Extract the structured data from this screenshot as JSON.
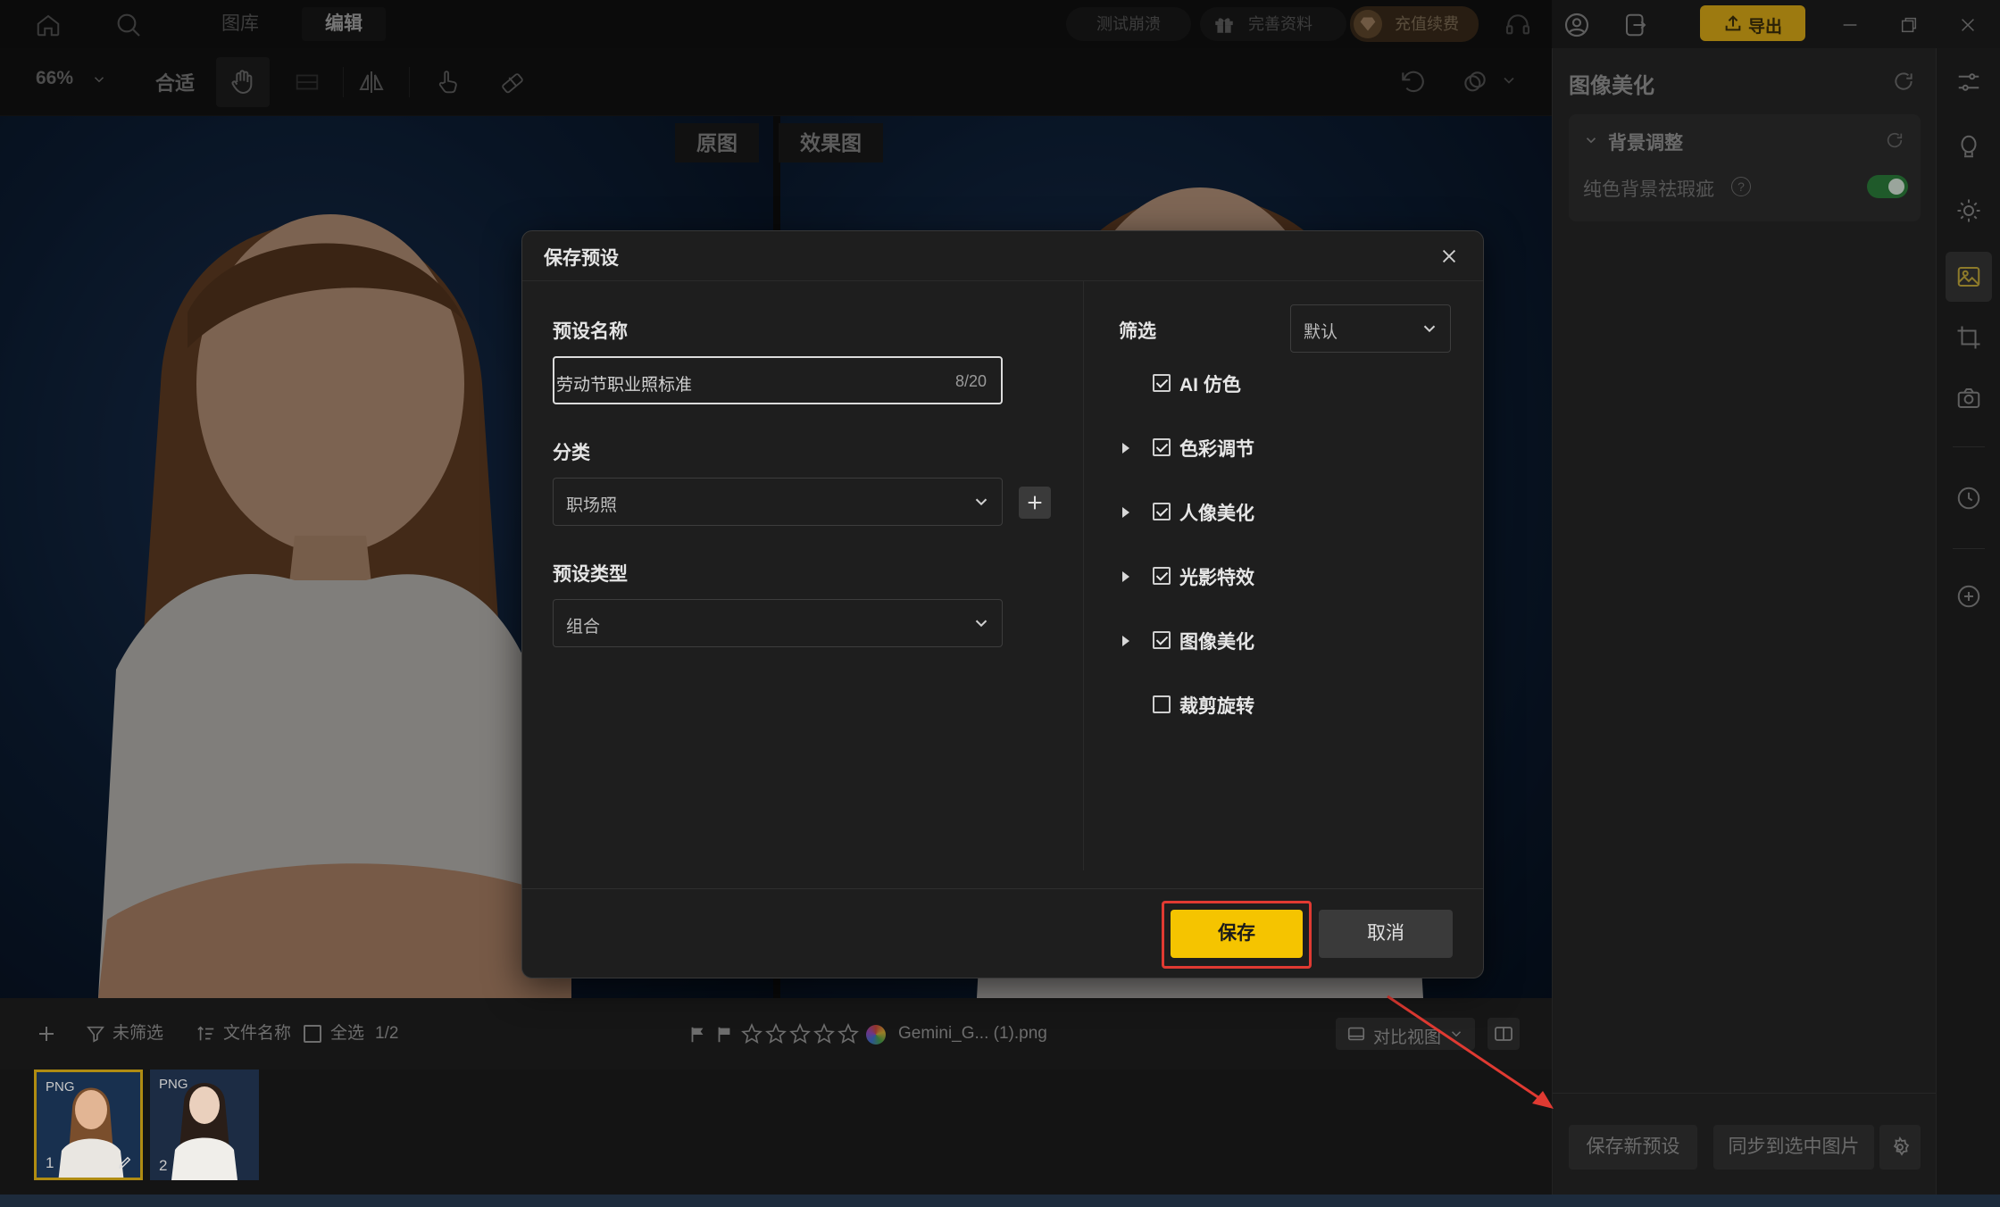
{
  "topbar": {
    "tabs": [
      {
        "label": "图库",
        "active": false
      },
      {
        "label": "编辑",
        "active": true
      }
    ],
    "test_crash": "测试崩溃",
    "complete_info": "完善资料",
    "recharge": "充值续费",
    "export": "导出"
  },
  "toolbar": {
    "zoom": "66%",
    "fit": "合适"
  },
  "canvas": {
    "original_label": "原图",
    "effect_label": "效果图"
  },
  "filmbar": {
    "unfiltered": "未筛选",
    "filename_sort": "文件名称",
    "select_all": "全选",
    "count": "1/2",
    "file_name": "Gemini_G... (1).png",
    "compare_view": "对比视图"
  },
  "thumbnails": [
    {
      "format": "PNG",
      "index": "1"
    },
    {
      "format": "PNG",
      "index": "2"
    }
  ],
  "right_panel": {
    "title": "图像美化",
    "section_title": "背景调整",
    "bg_option": "纯色背景祛瑕疵",
    "save_new_preset": "保存新预设",
    "sync_to_selected": "同步到选中图片"
  },
  "modal": {
    "title": "保存预设",
    "preset_name_label": "预设名称",
    "preset_name_value": "劳动节职业照标准",
    "preset_name_count": "8/20",
    "category_label": "分类",
    "category_value": "职场照",
    "preset_type_label": "预设类型",
    "preset_type_value": "组合",
    "filter_label": "筛选",
    "filter_value": "默认",
    "options": [
      {
        "label": "AI 仿色",
        "checked": true,
        "expandable": false
      },
      {
        "label": "色彩调节",
        "checked": true,
        "expandable": true
      },
      {
        "label": "人像美化",
        "checked": true,
        "expandable": true
      },
      {
        "label": "光影特效",
        "checked": true,
        "expandable": true
      },
      {
        "label": "图像美化",
        "checked": true,
        "expandable": true
      },
      {
        "label": "裁剪旋转",
        "checked": false,
        "expandable": false
      }
    ],
    "save": "保存",
    "cancel": "取消"
  },
  "colors": {
    "accent_yellow": "#f5c400",
    "highlight_red": "#e03a32",
    "toggle_green": "#2fb14c"
  }
}
